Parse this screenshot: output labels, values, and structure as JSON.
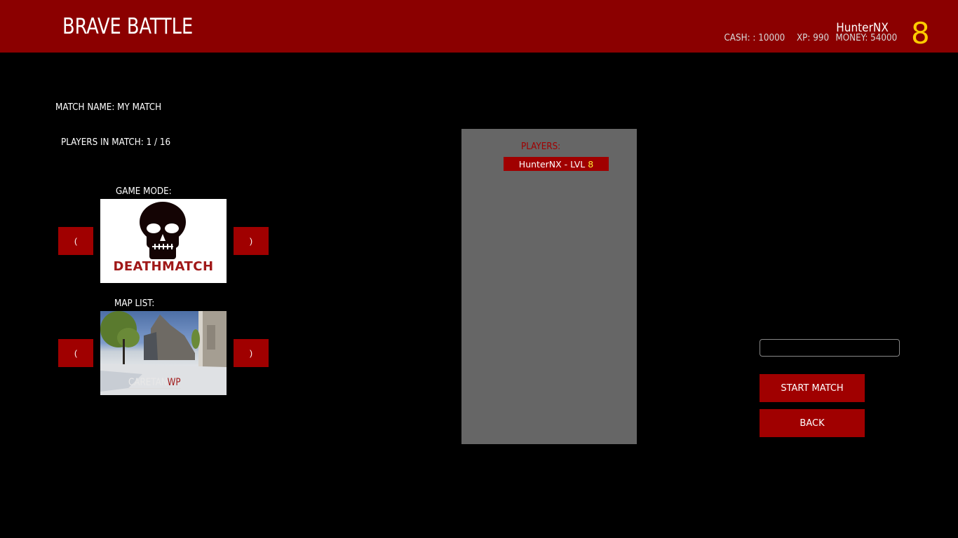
{
  "header": {
    "title": "BRAVE BATTLE",
    "username": "HunterNX",
    "cash": "CASH: : 10000",
    "xp": "XP: 990",
    "money": "MONEY: 54000",
    "level": "8"
  },
  "match": {
    "name_label": "MATCH NAME: MY MATCH",
    "players_label": "PLAYERS IN MATCH: 1 / 16"
  },
  "game_mode": {
    "label": "GAME MODE:",
    "selected": "DEATHMATCH",
    "prev_label": "(",
    "next_label": ")"
  },
  "map_list": {
    "label": "MAP LIST:",
    "selected_name": "CARETAN",
    "selected_suffix": "WP",
    "prev_label": "(",
    "next_label": ")"
  },
  "players_panel": {
    "title": "PLAYERS:",
    "players": [
      {
        "name": "HunterNX - LVL",
        "level": "8"
      }
    ]
  },
  "actions": {
    "input_value": "",
    "input_placeholder": "",
    "start_label": "START MATCH",
    "back_label": "BACK"
  },
  "colors": {
    "header_bg": "#8b0000",
    "button_bg": "#a00000",
    "level_yellow": "#ffcc00",
    "panel_gray": "#666666"
  }
}
